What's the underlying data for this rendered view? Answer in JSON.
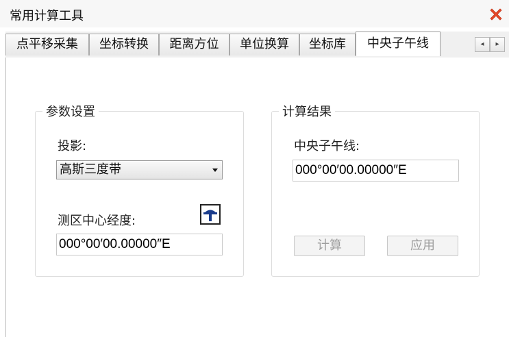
{
  "window": {
    "title": "常用计算工具",
    "close_icon": "close-x-icon",
    "close_color": "#e8492a"
  },
  "tabs": [
    {
      "label": "点平移采集",
      "active": false
    },
    {
      "label": "坐标转换",
      "active": false
    },
    {
      "label": "距离方位",
      "active": false
    },
    {
      "label": "单位换算",
      "active": false
    },
    {
      "label": "坐标库",
      "active": false
    },
    {
      "label": "中央子午线",
      "active": true
    }
  ],
  "tab_scroll": {
    "left_icon": "◂",
    "right_icon": "▸"
  },
  "params": {
    "title": "参数设置",
    "projection_label": "投影:",
    "projection_value": "高斯三度带",
    "longitude_label": "测区中心经度:",
    "longitude_value": "000°00′00.00000″E",
    "pick_icon": "pin-pick-icon",
    "pick_icon_color": "#1a3c8c"
  },
  "result": {
    "title": "计算结果",
    "meridian_label": "中央子午线:",
    "meridian_value": "000°00′00.00000″E",
    "calc_button": "计算",
    "apply_button": "应用"
  }
}
